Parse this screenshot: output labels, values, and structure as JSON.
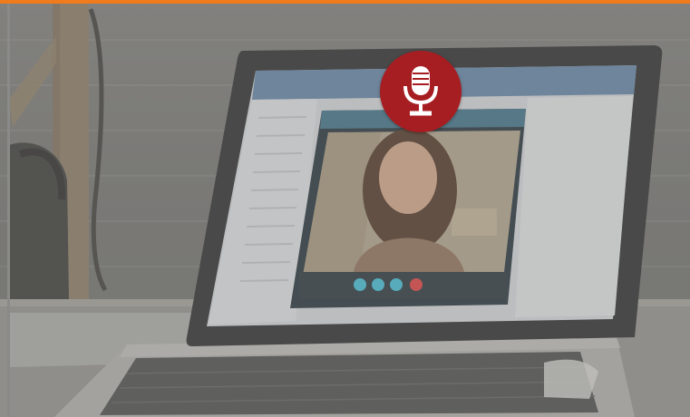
{
  "colors": {
    "accent_bar": "#f07b1c",
    "mic_badge": "#a61e22",
    "mic_glyph": "#ffffff"
  },
  "icons": {
    "mic": "microphone-icon"
  },
  "scene": {
    "subject": "laptop-video-call",
    "call_controls": [
      "call-control-blue-1",
      "call-control-blue-2",
      "call-control-blue-3",
      "end-call-red"
    ]
  }
}
